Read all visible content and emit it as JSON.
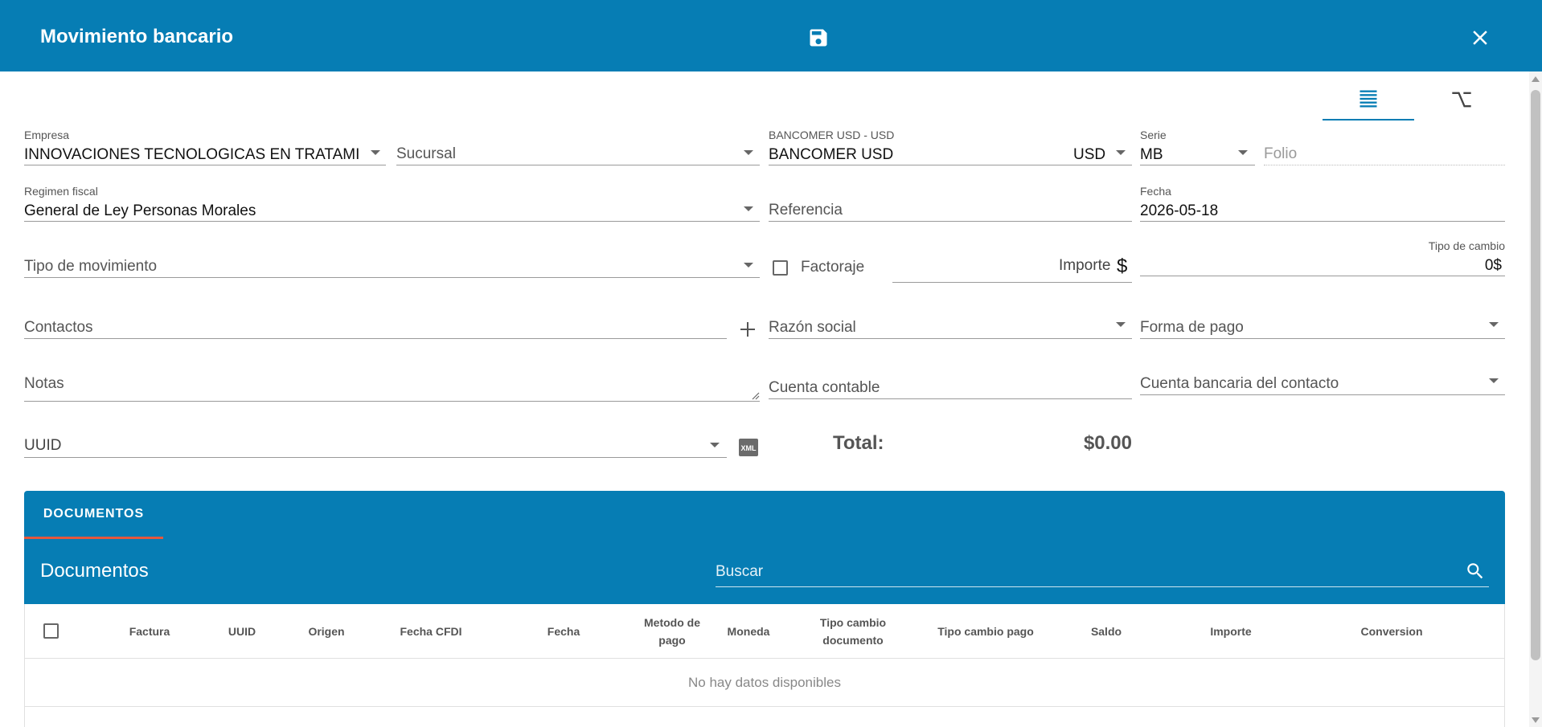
{
  "header": {
    "title": "Movimiento bancario"
  },
  "fields": {
    "empresa": {
      "label": "Empresa",
      "value": "INNOVACIONES TECNOLOGICAS EN TRATAMIE"
    },
    "sucursal": {
      "placeholder": "Sucursal"
    },
    "banco": {
      "label": "BANCOMER USD - USD",
      "value": "BANCOMER USD",
      "currency": "USD"
    },
    "serie": {
      "label": "Serie",
      "value": "MB"
    },
    "folio": {
      "placeholder": "Folio"
    },
    "regimen": {
      "label": "Regimen fiscal",
      "value": "General de Ley Personas Morales"
    },
    "referencia": {
      "placeholder": "Referencia"
    },
    "fecha": {
      "label": "Fecha",
      "value": "2026-05-18"
    },
    "tipo_movimiento": {
      "placeholder": "Tipo de movimiento"
    },
    "factoraje": {
      "label": "Factoraje",
      "checked": false
    },
    "importe": {
      "label": "Importe",
      "symbol": "$"
    },
    "tipo_cambio": {
      "label": "Tipo de cambio",
      "value": "0$"
    },
    "contactos": {
      "placeholder": "Contactos"
    },
    "razon_social": {
      "placeholder": "Razón social"
    },
    "forma_pago": {
      "placeholder": "Forma de pago"
    },
    "notas": {
      "placeholder": "Notas"
    },
    "cuenta_contable": {
      "placeholder": "Cuenta contable"
    },
    "cuenta_bancaria": {
      "placeholder": "Cuenta bancaria del contacto"
    },
    "uuid": {
      "label": "UUID"
    }
  },
  "total": {
    "label": "Total:",
    "value": "$0.00"
  },
  "documents": {
    "tab": "DOCUMENTOS",
    "title": "Documentos",
    "search_placeholder": "Buscar",
    "columns": [
      "Factura",
      "UUID",
      "Origen",
      "Fecha CFDI",
      "Fecha",
      "Metodo de pago",
      "Moneda",
      "Tipo cambio documento",
      "Tipo cambio pago",
      "Saldo",
      "Importe",
      "Conversion"
    ],
    "empty_text": "No hay datos disponibles"
  },
  "icons": {
    "save": "save-icon",
    "close": "close-icon",
    "list": "list-icon",
    "option": "option-key-icon",
    "add": "plus-icon",
    "xml": "xml-file-icon",
    "search": "search-icon"
  },
  "colors": {
    "primary": "#067db4",
    "tab_indicator": "#e4573d"
  }
}
